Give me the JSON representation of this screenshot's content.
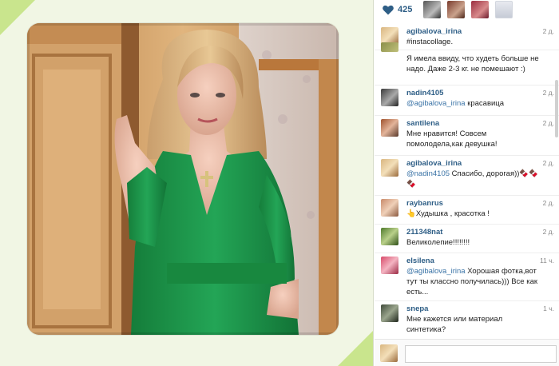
{
  "likes": {
    "count": "425"
  },
  "comments": [
    {
      "user": "agibalova_irina",
      "mention": "",
      "text": "#instacollage.",
      "time": "2 д."
    },
    {
      "user": "",
      "mention": "",
      "text": "Я имела ввиду, что худеть больше не надо. Даже 2-3 кг. не помешают :)",
      "time": ""
    },
    {
      "user": "nadin4105",
      "mention": "@agibalova_irina",
      "text": " красавица",
      "time": "2 д."
    },
    {
      "user": "santilena",
      "mention": "",
      "text": "Мне нравится! Совсем помолодела,как девушка!",
      "time": "2 д."
    },
    {
      "user": "agibalova_irina",
      "mention": "@nadin4105",
      "text": " Спасибо, дорогая))🍫🍫🍫",
      "time": "2 д."
    },
    {
      "user": "raybanrus",
      "mention": "",
      "text": "👆Худышка , красотка !",
      "time": "2 д."
    },
    {
      "user": "211348nat",
      "mention": "",
      "text": "Великолепие!!!!!!!!",
      "time": "2 д."
    },
    {
      "user": "elsilena",
      "mention": "@agibalova_irina",
      "text": " Хорошая фотка,вот тут ты классно получилась))) Все как есть...",
      "time": "11 ч."
    },
    {
      "user": "snepa",
      "mention": "",
      "text": "Мне кажется или материал синтетика?",
      "time": "1 ч."
    }
  ],
  "composer": {
    "placeholder": ""
  },
  "colors": {
    "username": "#2e5e86",
    "mention": "#3a73a6",
    "frame_bg": "#f1f6e4",
    "frame_corner": "#c9e58d",
    "dress": "#1f9a4d"
  },
  "icons": {
    "likes": "heart-icon"
  }
}
